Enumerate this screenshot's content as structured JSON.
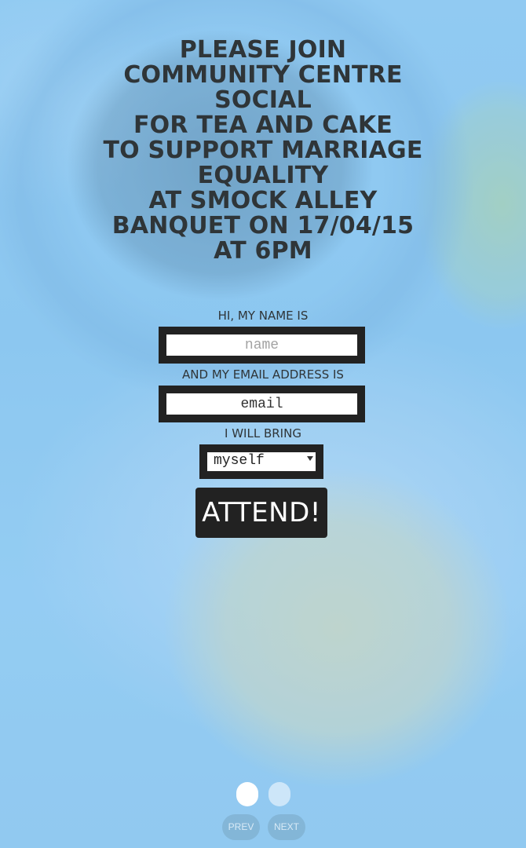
{
  "headline": {
    "lines": [
      "PLEASE JOIN",
      "COMMUNITY CENTRE",
      "SOCIAL",
      "FOR TEA AND CAKE",
      "TO SUPPORT MARRIAGE",
      "EQUALITY",
      "AT SMOCK ALLEY",
      "BANQUET ON 17/04/15",
      "AT 6PM"
    ]
  },
  "form": {
    "name_label": "HI, MY NAME IS",
    "name_placeholder": "name",
    "email_label": "AND MY EMAIL ADDRESS IS",
    "email_placeholder": "email",
    "bring_label": "I WILL BRING",
    "bring_selected": "myself",
    "submit_label": "ATTEND!"
  },
  "pagination": {
    "prev_label": "PREV",
    "next_label": "NEXT",
    "pages": 2,
    "current": 1
  },
  "colors": {
    "text": "#2f3538",
    "button": "#222222",
    "background": "#8ec9f0"
  }
}
